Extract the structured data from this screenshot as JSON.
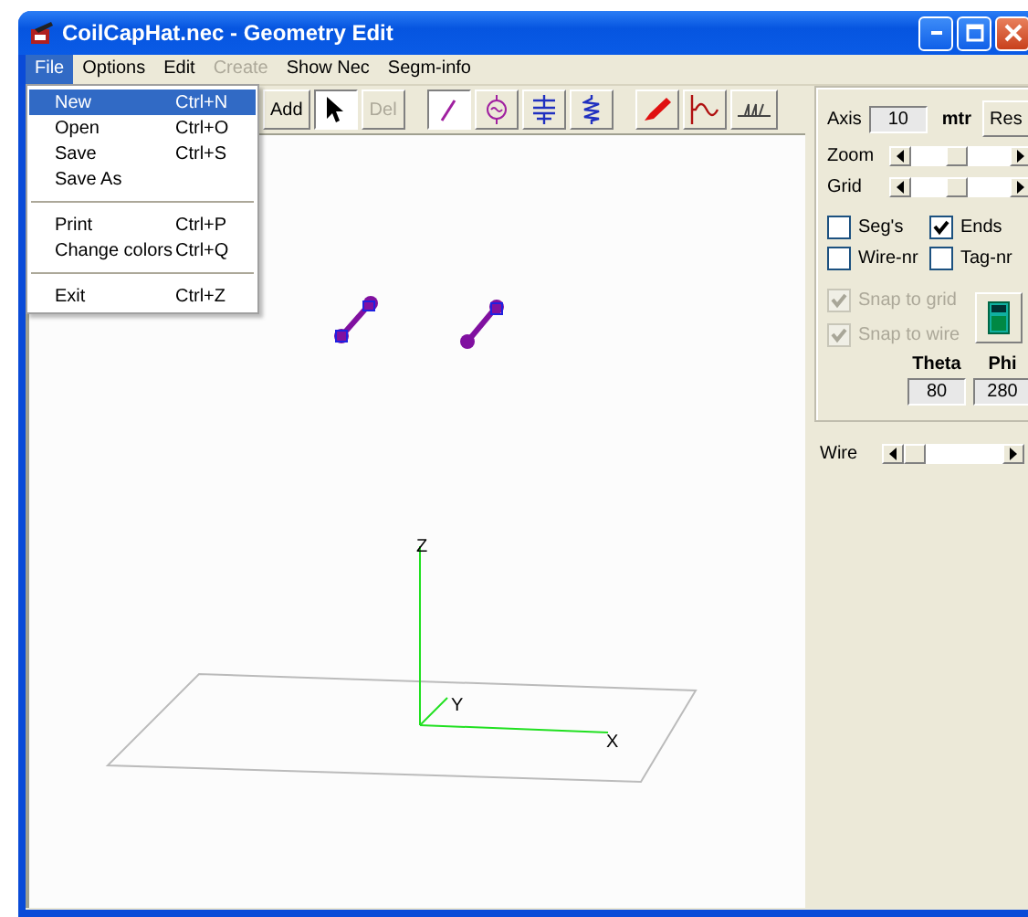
{
  "window": {
    "title": "CoilCapHat.nec - Geometry Edit"
  },
  "menu": [
    {
      "label": "File",
      "selected": true,
      "disabled": false
    },
    {
      "label": "Options",
      "selected": false,
      "disabled": false
    },
    {
      "label": "Edit",
      "selected": false,
      "disabled": false
    },
    {
      "label": "Create",
      "selected": false,
      "disabled": true
    },
    {
      "label": "Show Nec",
      "selected": false,
      "disabled": false
    },
    {
      "label": "Segm-info",
      "selected": false,
      "disabled": false
    }
  ],
  "file_menu": [
    {
      "kind": "item",
      "label": "New",
      "shortcut": "Ctrl+N",
      "selected": true
    },
    {
      "kind": "item",
      "label": "Open",
      "shortcut": "Ctrl+O",
      "selected": false
    },
    {
      "kind": "item",
      "label": "Save",
      "shortcut": "Ctrl+S",
      "selected": false
    },
    {
      "kind": "item",
      "label": "Save As",
      "selected": false
    },
    {
      "kind": "separator"
    },
    {
      "kind": "item",
      "label": "Print",
      "shortcut": "Ctrl+P",
      "selected": false
    },
    {
      "kind": "item",
      "label": "Change colors",
      "shortcut": "Ctrl+Q",
      "selected": false
    },
    {
      "kind": "separator"
    },
    {
      "kind": "item",
      "label": "Exit",
      "shortcut": "Ctrl+Z",
      "selected": false
    }
  ],
  "toolbar": [
    [
      {
        "kind": "text",
        "label": "Add",
        "selected": false,
        "disabled": false
      },
      {
        "kind": "pointer",
        "selected": true,
        "disabled": false
      },
      {
        "kind": "text",
        "label": "Del",
        "selected": false,
        "disabled": true
      }
    ],
    [
      {
        "kind": "wire",
        "selected": true,
        "disabled": false
      },
      {
        "kind": "source",
        "selected": false,
        "disabled": false
      },
      {
        "kind": "capacitor",
        "selected": false,
        "disabled": false
      },
      {
        "kind": "coil",
        "selected": false,
        "disabled": false
      }
    ],
    [
      {
        "kind": "pen",
        "selected": false,
        "disabled": false
      },
      {
        "kind": "wave",
        "selected": false,
        "disabled": false
      },
      {
        "kind": "ground",
        "selected": false,
        "disabled": false
      }
    ]
  ],
  "canvas": {
    "axes": [
      {
        "label": "Z"
      },
      {
        "label": "Y"
      },
      {
        "label": "X"
      }
    ]
  },
  "panel": {
    "axis": {
      "label": "Axis",
      "value": "10",
      "unit": "mtr"
    },
    "reset_button": "Res",
    "sliders": [
      {
        "label": "Zoom",
        "level": 0.45
      },
      {
        "label": "Grid",
        "level": 0.45
      }
    ],
    "checkboxes": [
      {
        "label": "Seg's",
        "checked": false,
        "disabled": false
      },
      {
        "label": "Ends",
        "checked": true,
        "disabled": false
      },
      {
        "label": "Wire-nr",
        "checked": false,
        "disabled": false
      },
      {
        "label": "Tag-nr",
        "checked": false,
        "disabled": false
      },
      {
        "label": "Snap to grid",
        "checked": true,
        "disabled": true
      },
      {
        "label": "Snap to wire",
        "checked": true,
        "disabled": true
      }
    ],
    "angles": [
      {
        "label": "Theta",
        "value": "80"
      },
      {
        "label": "Phi",
        "value": "280"
      }
    ],
    "wire_slider": {
      "label": "Wire",
      "level": 0
    }
  }
}
